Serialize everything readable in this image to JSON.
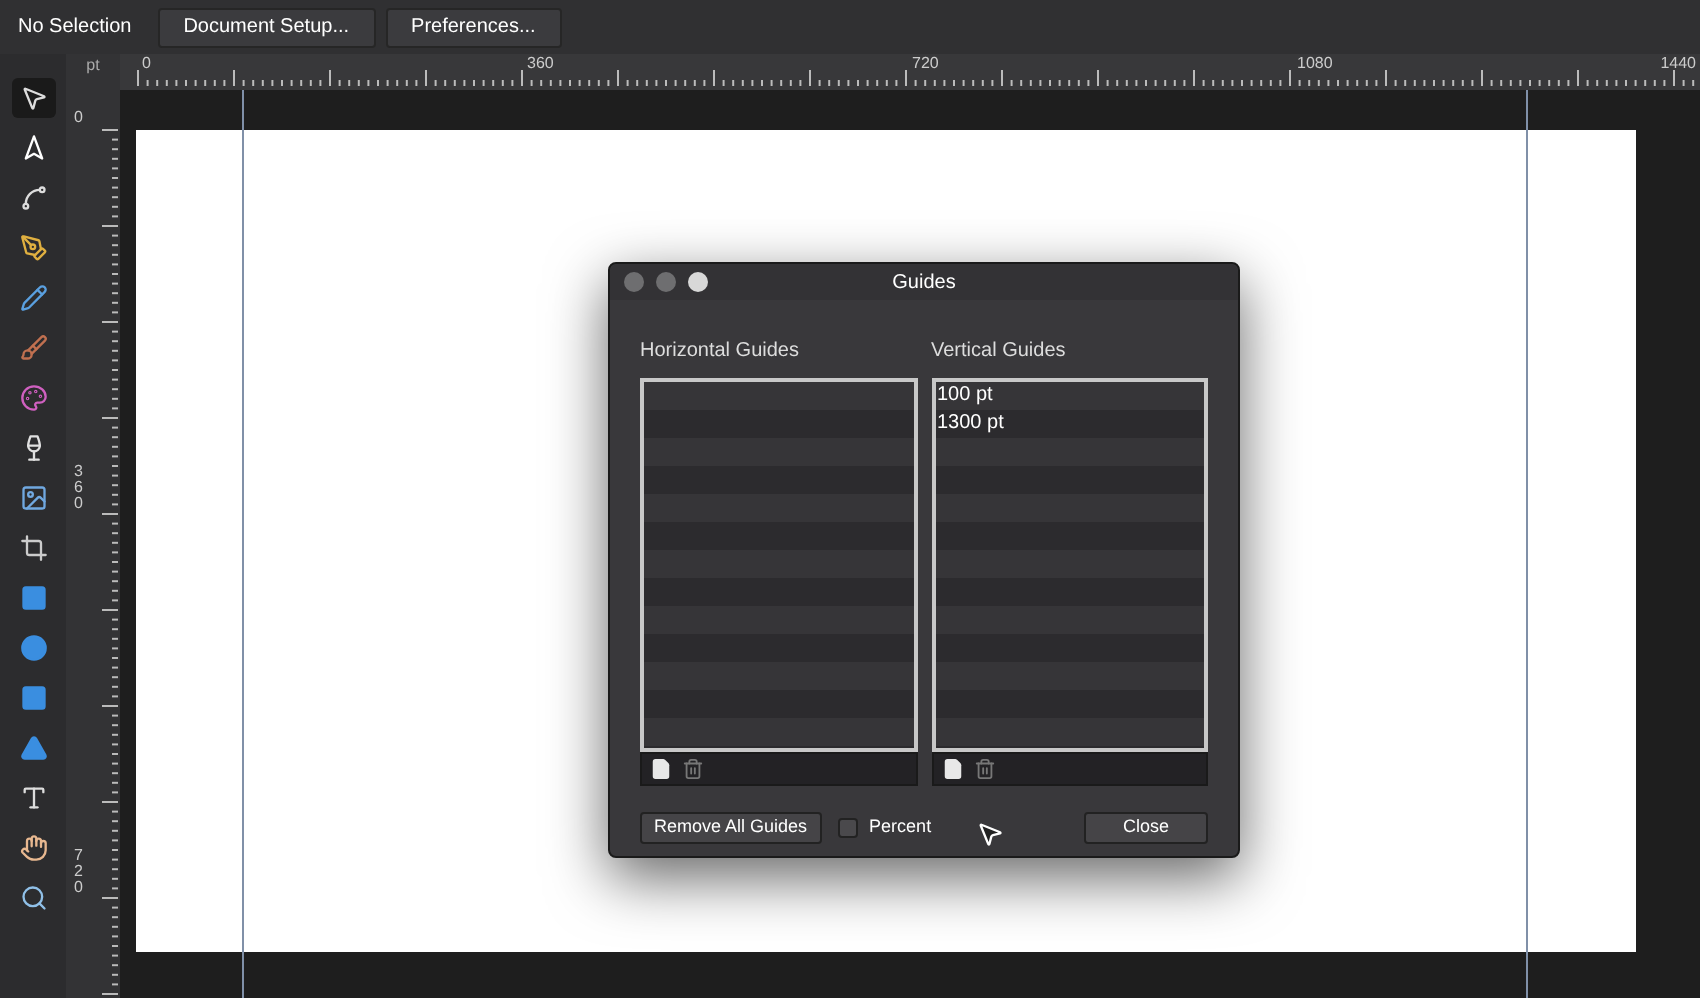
{
  "context_bar": {
    "status": "No Selection",
    "buttons": [
      "Document Setup...",
      "Preferences..."
    ]
  },
  "ruler": {
    "unit": "pt",
    "horizontal_labels": [
      "0",
      "360",
      "720",
      "1080",
      "1440"
    ],
    "vertical_labels": [
      "0",
      "360",
      "720"
    ]
  },
  "tools": [
    {
      "selected": true
    },
    {
      "selected": false
    },
    {
      "selected": false
    },
    {
      "selected": false
    },
    {
      "selected": false
    },
    {
      "selected": false
    },
    {
      "selected": false
    },
    {
      "selected": false
    },
    {
      "selected": false
    },
    {
      "selected": false
    },
    {
      "selected": false
    },
    {
      "selected": false
    },
    {
      "selected": false
    },
    {
      "selected": false
    },
    {
      "selected": false
    },
    {
      "selected": false
    },
    {
      "selected": false
    }
  ],
  "dialog": {
    "title": "Guides",
    "horizontal_guides": {
      "label": "Horizontal Guides"
    },
    "vertical_guides": {
      "label": "Vertical Guides",
      "items": [
        "100 pt",
        "1300 pt"
      ]
    },
    "remove_button": "Remove All Guides",
    "percent": {
      "label": "Percent",
      "checked": false
    },
    "close_button": "Close"
  }
}
